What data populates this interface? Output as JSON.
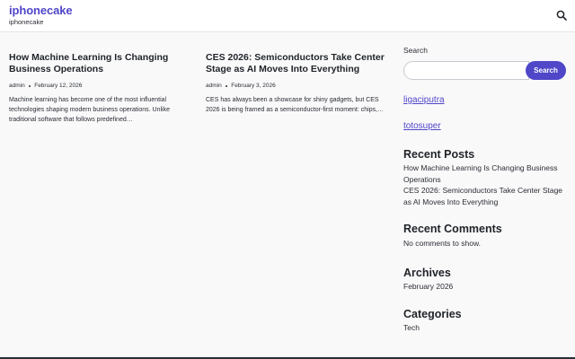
{
  "header": {
    "site_title": "iphonecake",
    "tagline": "iphonecake",
    "search_icon": "search-icon"
  },
  "posts": [
    {
      "title": "How Machine Learning Is Changing Business Operations",
      "author": "admin",
      "date": "February 12, 2026",
      "excerpt": "Machine learning has become one of the most influential technologies shaping modern business operations. Unlike traditional software that follows predefined…"
    },
    {
      "title": "CES 2026: Semiconductors Take Center Stage as AI Moves Into Everything",
      "author": "admin",
      "date": "February 3, 2026",
      "excerpt": "CES has always been a showcase for shiny gadgets, but CES 2026 is being framed as a semiconductor-first moment: chips,…"
    }
  ],
  "sidebar": {
    "search_label": "Search",
    "search_value": "",
    "search_button": "Search",
    "links": [
      "ligaciputra",
      "totosuper"
    ],
    "recent_posts_title": "Recent Posts",
    "recent_posts": [
      "How Machine Learning Is Changing Business Operations",
      "CES 2026: Semiconductors Take Center Stage as AI Moves Into Everything"
    ],
    "recent_comments_title": "Recent Comments",
    "recent_comments_text": "No comments to show.",
    "archives_title": "Archives",
    "archives": [
      "February 2026"
    ],
    "categories_title": "Categories",
    "categories": [
      "Tech"
    ]
  },
  "colors": {
    "accent": "#4f46c8",
    "text": "#1f2328",
    "background": "#f9f9fa"
  }
}
